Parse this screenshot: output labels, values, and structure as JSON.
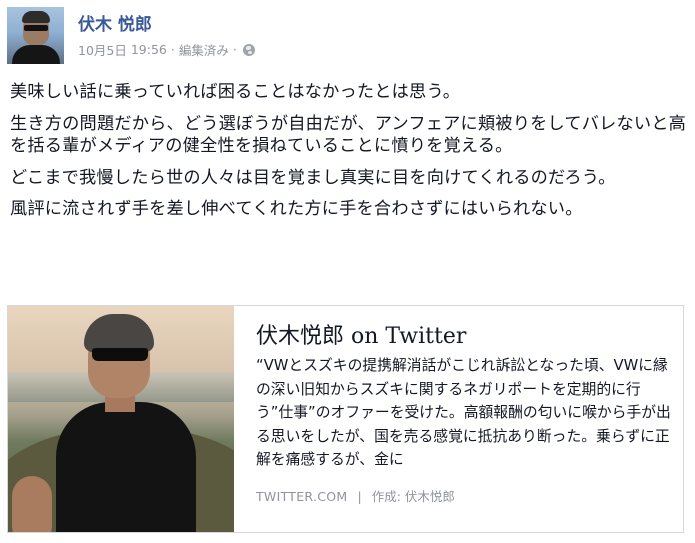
{
  "post": {
    "author": "伏木 悦郎",
    "date": "10月5日",
    "time": "19:56",
    "separator": "·",
    "edited_label": "編集済み",
    "privacy_icon": "globe-icon",
    "paragraphs": [
      "美味しい話に乗っていれば困ることはなかったとは思う。",
      "生き方の問題だから、どう選ぼうが自由だが、アンフェアに頬被りをしてバレないと高を括る輩がメディアの健全性を損ねていることに憤りを覚える。",
      "どこまで我慢したら世の人々は目を覚まし真実に目を向けてくれるのだろう。",
      "風評に流されず手を差し伸べてくれた方に手を合わさずにはいられない。"
    ]
  },
  "link_card": {
    "title": "伏木悦郎 on Twitter",
    "description": "“VWとスズキの提携解消話がこじれ訴訟となった頃、VWに縁の深い旧知からスズキに関するネガリポートを定期的に行う”仕事”のオファーを受けた。高額報酬の匂いに喉から手が出る思いをしたが、国を売る感覚に抵抗あり断った。乗らずに正解を痛感するが、金に",
    "domain": "TWITTER.COM",
    "separator": "|",
    "author_label": "作成: 伏木悦郎"
  },
  "colors": {
    "link_blue": "#3b5998",
    "meta_gray": "#90949c",
    "text": "#141823",
    "card_border": "#d4d7dc"
  }
}
